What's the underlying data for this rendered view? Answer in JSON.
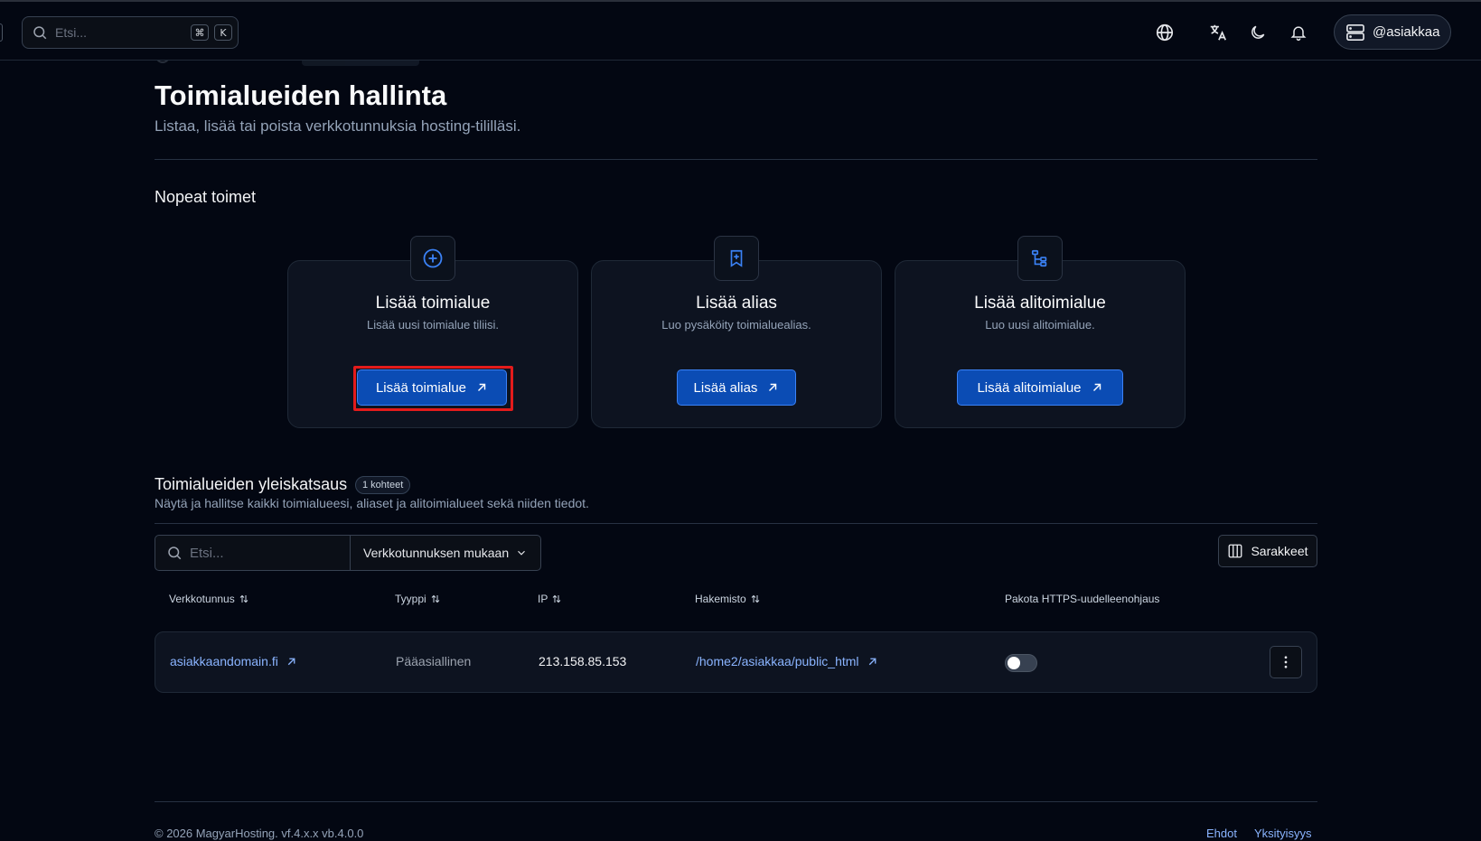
{
  "topbar": {
    "search_placeholder": "Etsi...",
    "shortcut_mod": "⌘",
    "shortcut_key": "K",
    "user_label": "@asiakkaa"
  },
  "header": {
    "title": "Toimialueiden hallinta",
    "subtitle": "Listaa, lisää tai poista verkkotunnuksia hosting-tililläsi."
  },
  "quick_actions": {
    "title": "Nopeat toimet",
    "cards": [
      {
        "title": "Lisää toimialue",
        "desc": "Lisää uusi toimialue tiliisi.",
        "button": "Lisää toimialue",
        "icon": "plus-circle-icon"
      },
      {
        "title": "Lisää alias",
        "desc": "Luo pysäköity toimialuealias.",
        "button": "Lisää alias",
        "icon": "bookmark-plus-icon"
      },
      {
        "title": "Lisää alitoimialue",
        "desc": "Luo uusi alitoimialue.",
        "button": "Lisää alitoimialue",
        "icon": "tree-icon"
      }
    ]
  },
  "overview": {
    "title": "Toimialueiden yleiskatsaus",
    "badge": "1 kohteet",
    "subtitle": "Näytä ja hallitse kaikki toimialueesi, aliaset ja alitoimialueet sekä niiden tiedot.",
    "search_placeholder": "Etsi...",
    "filter_value": "Verkkotunnuksen mukaan",
    "columns_button": "Sarakkeet",
    "columns": [
      "Verkkotunnus",
      "Tyyppi",
      "IP",
      "Hakemisto",
      "Pakota HTTPS-uudelleenohjaus"
    ],
    "rows": [
      {
        "domain": "asiakkaandomain.fi",
        "type": "Pääasiallinen",
        "ip": "213.158.85.153",
        "directory": "/home2/asiakkaa/public_html",
        "https_redirect": false
      }
    ]
  },
  "footer": {
    "copyright": "© 2026 MagyarHosting. vf.4.x.x vb.4.0.0",
    "terms": "Ehdot",
    "privacy": "Yksityisyys"
  },
  "colors": {
    "background": "#030712",
    "primary_button": "#0b4cb4",
    "link": "#8ab4ff",
    "highlight": "#e31b1b"
  }
}
